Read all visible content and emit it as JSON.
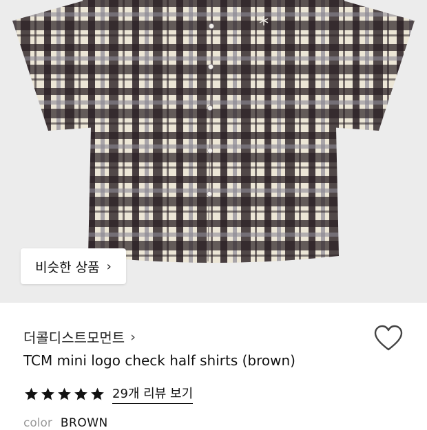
{
  "product_image": {
    "alt": "check half shirts"
  },
  "similar_button": {
    "label": "비슷한 상품",
    "chevron": "›"
  },
  "brand": {
    "name": "더콜디스트모먼트",
    "chevron": "›"
  },
  "wishlist": {
    "icon": "heart-outline-icon"
  },
  "product": {
    "title": "TCM mini logo check half shirts (brown)"
  },
  "rating": {
    "stars": 5,
    "max": 5,
    "reviews_label": "29개 리뷰 보기"
  },
  "option": {
    "label": "color",
    "value": "BROWN"
  },
  "colors": {
    "hero_bg": "#ececec",
    "plaid_dark": "#2a2024",
    "plaid_cream": "#ece6d6",
    "plaid_grey": "#8c8894",
    "star": "#111111"
  }
}
